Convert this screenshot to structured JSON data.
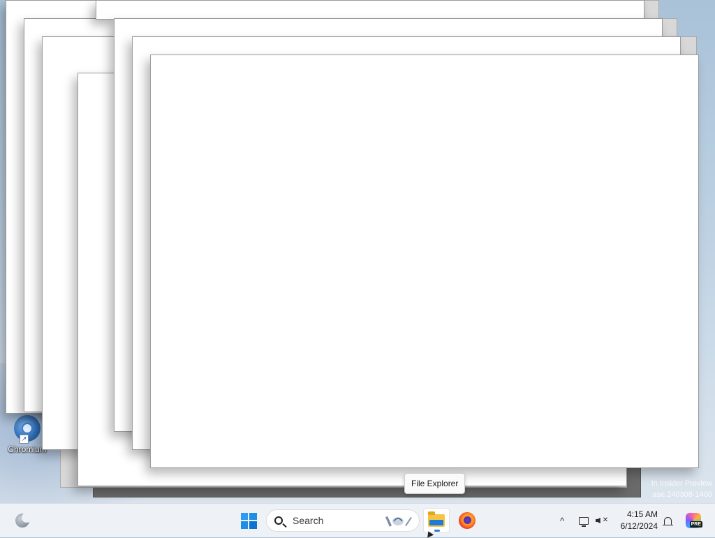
{
  "desktop": {
    "icons": [
      {
        "label": "Chromium",
        "icon": "chromium-icon"
      }
    ],
    "watermark": {
      "line1": "In Insider Preview",
      "line2": "ase.240308-1400"
    }
  },
  "tooltip": {
    "text": "File Explorer"
  },
  "taskbar": {
    "widgets_icon": "widgets-moon-icon",
    "start_icon": "windows-start-icon",
    "search": {
      "placeholder": "Search",
      "icon": "search-icon"
    },
    "pinned_apps": [
      {
        "name": "File Explorer",
        "icon": "folder-icon",
        "active": true
      },
      {
        "name": "Firefox",
        "icon": "firefox-icon",
        "active": false
      }
    ],
    "tray": {
      "overflow_icon": "chevron-up-icon",
      "network_icon": "network-icon",
      "volume_icon": "volume-muted-icon",
      "time": "4:15 AM",
      "date": "6/12/2024",
      "notification_icon": "bell-icon",
      "copilot_badge": "PRE"
    }
  },
  "colors": {
    "taskbar_bg": "#eef1f5",
    "window_bg": "#ffffff",
    "start_blue": "#1f8fe6"
  }
}
